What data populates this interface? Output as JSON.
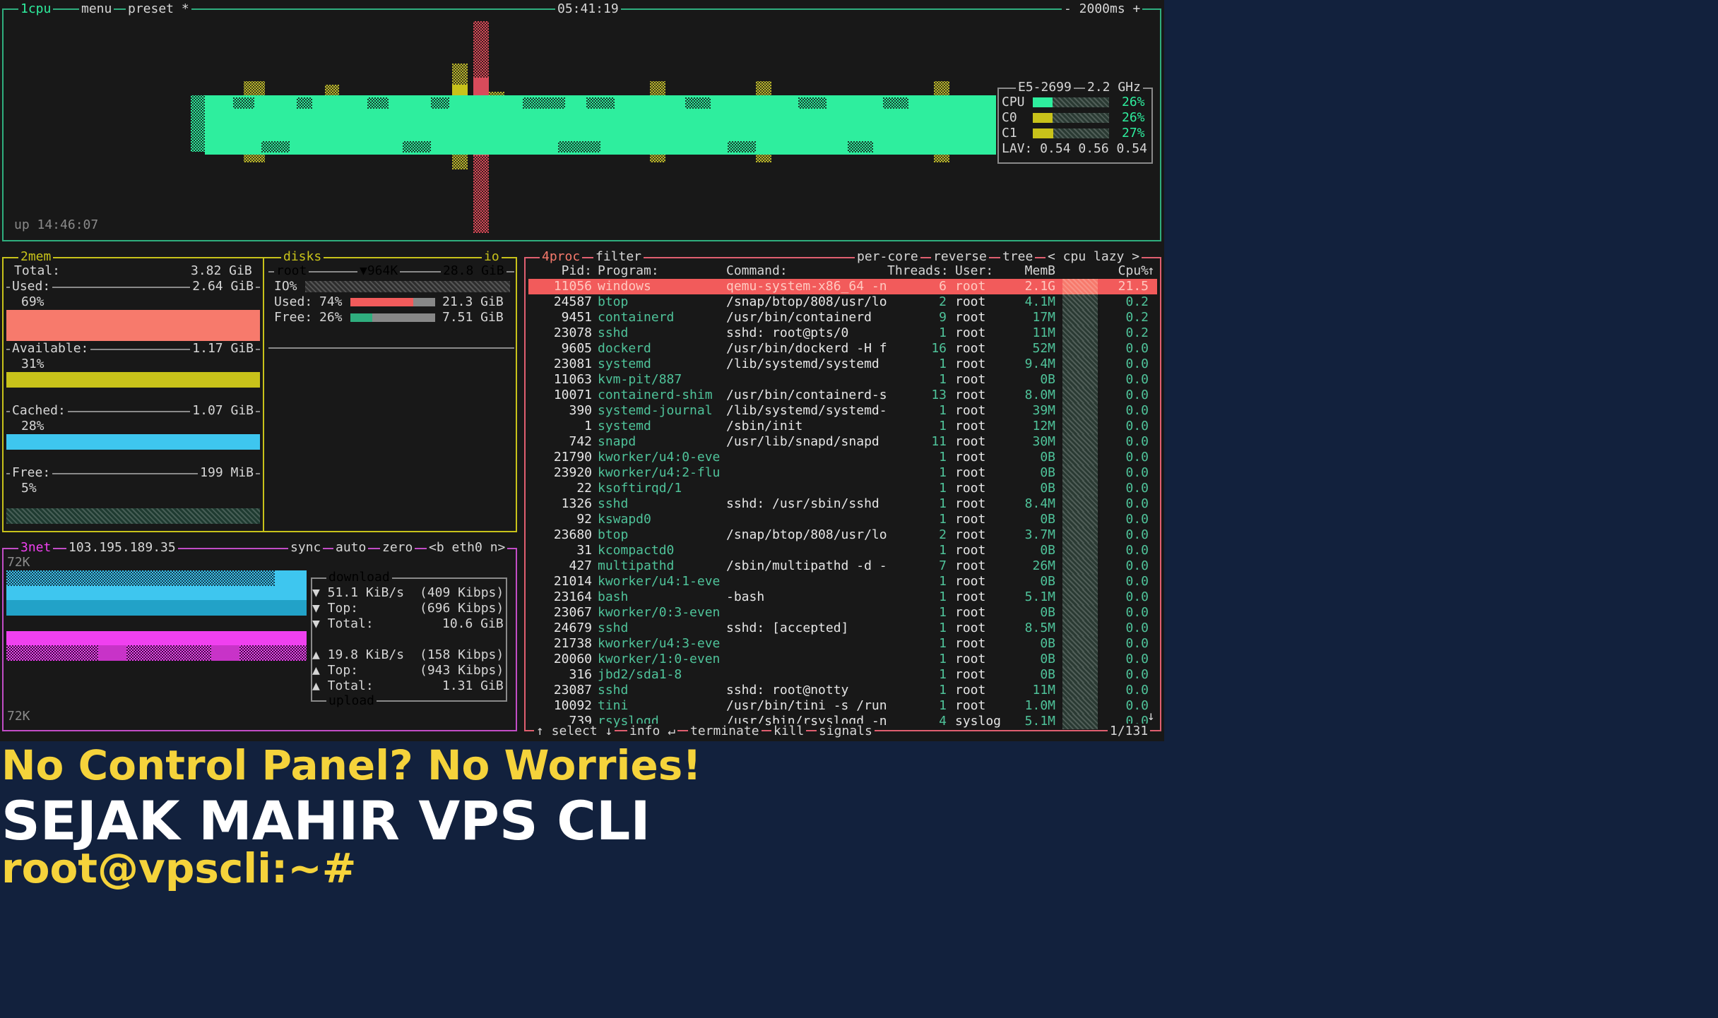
{
  "colors": {
    "cpu_border": "#2fae7e",
    "mem_border": "#c8c21a",
    "net_border": "#c24dc6",
    "proc_border": "#e05f70",
    "accent_green": "#2eee9e",
    "accent_yellow": "#c8c21a",
    "accent_cyan": "#3ec6ef",
    "accent_magenta": "#f040f0",
    "accent_red": "#f77a6c",
    "banner_bg": "#12213d",
    "banner_yellow": "#f5d33b"
  },
  "cpu_box": {
    "tab_cpu": "1cpu",
    "tab_menu": "menu",
    "tab_preset": "preset *",
    "clock": "05:41:19",
    "interval": "- 2000ms +",
    "uptime": "up 14:46:07",
    "model": "E5-2699",
    "freq": "2.2 GHz",
    "rows": [
      {
        "label": "CPU",
        "pct": "26%",
        "value": 0.26
      },
      {
        "label": "C0",
        "pct": "26%",
        "value": 0.26
      },
      {
        "label": "C1",
        "pct": "27%",
        "value": 0.27
      }
    ],
    "lav": "LAV: 0.54 0.56 0.54"
  },
  "mem_box": {
    "tab": "2mem",
    "total_label": "Total:",
    "total_value": "3.82 GiB",
    "items": [
      {
        "label": "Used:",
        "value": "2.64 GiB",
        "pct": "69%",
        "fraction": 0.69,
        "color": "#f77a6c"
      },
      {
        "label": "Available:",
        "value": "1.17 GiB",
        "pct": "31%",
        "fraction": 0.31,
        "color": "#c8c21a"
      },
      {
        "label": "Cached:",
        "value": "1.07 GiB",
        "pct": "28%",
        "fraction": 0.28,
        "color": "#3ec6ef"
      },
      {
        "label": "Free:",
        "value": "199 MiB",
        "pct": "5%",
        "fraction": 0.05,
        "color": "#2fae7e"
      }
    ]
  },
  "disks_box": {
    "tab": "disks",
    "io_tab": "io",
    "root_label": "root",
    "root_io": "▼964K",
    "root_size": "28.8 GiB",
    "io_label": "IO%",
    "used_label": "Used:",
    "used_pct": "74%",
    "used_fraction": 0.74,
    "used_size": "21.3 GiB",
    "free_label": "Free:",
    "free_pct": "26%",
    "free_fraction": 0.26,
    "free_size": "7.51 GiB"
  },
  "net_box": {
    "tab": "3net",
    "ip": "103.195.189.35",
    "tab_sync": "sync",
    "tab_auto": "auto",
    "tab_zero": "zero",
    "tab_iface": "<b eth0 n>",
    "scale_top": "72K",
    "scale_bottom": "72K",
    "download_label": "download",
    "upload_label": "upload",
    "down_rate": "▼ 51.1 KiB/s",
    "down_rate_bits": "(409 Kibps)",
    "down_top": "▼ Top:",
    "down_top_value": "(696 Kibps)",
    "down_total": "▼ Total:",
    "down_total_value": "10.6 GiB",
    "up_rate": "▲ 19.8 KiB/s",
    "up_rate_bits": "(158 Kibps)",
    "up_top": "▲ Top:",
    "up_top_value": "(943 Kibps)",
    "up_total": "▲ Total:",
    "up_total_value": "1.31 GiB"
  },
  "proc_box": {
    "tab": "4proc",
    "filter": "filter",
    "per_core": "per-core",
    "reverse": "reverse",
    "tree": "tree",
    "sort": "< cpu lazy >",
    "headers": {
      "pid": "Pid:",
      "program": "Program:",
      "command": "Command:",
      "threads": "Threads:",
      "user": "User:",
      "mem": "MemB",
      "cpu": "Cpu%"
    },
    "footer_select": "↑ select ↓",
    "footer_info": "info ↵",
    "footer_terminate": "terminate",
    "footer_kill": "kill",
    "footer_signals": "signals",
    "footer_count": "1/131",
    "scroll_up": "↑",
    "scroll_down": "↓",
    "rows": [
      {
        "pid": "11056",
        "program": "windows",
        "command": "qemu-system-x86_64 -n",
        "threads": "6",
        "user": "root",
        "mem": "2.1G",
        "cpu": "21.5"
      },
      {
        "pid": "24587",
        "program": "btop",
        "command": "/snap/btop/808/usr/lo",
        "threads": "2",
        "user": "root",
        "mem": "4.1M",
        "cpu": "0.2"
      },
      {
        "pid": "9451",
        "program": "containerd",
        "command": "/usr/bin/containerd",
        "threads": "9",
        "user": "root",
        "mem": "17M",
        "cpu": "0.2"
      },
      {
        "pid": "23078",
        "program": "sshd",
        "command": "sshd: root@pts/0",
        "threads": "1",
        "user": "root",
        "mem": "11M",
        "cpu": "0.2"
      },
      {
        "pid": "9605",
        "program": "dockerd",
        "command": "/usr/bin/dockerd -H f",
        "threads": "16",
        "user": "root",
        "mem": "52M",
        "cpu": "0.0"
      },
      {
        "pid": "23081",
        "program": "systemd",
        "command": "/lib/systemd/systemd",
        "threads": "1",
        "user": "root",
        "mem": "9.4M",
        "cpu": "0.0"
      },
      {
        "pid": "11063",
        "program": "kvm-pit/887",
        "command": "",
        "threads": "1",
        "user": "root",
        "mem": "0B",
        "cpu": "0.0"
      },
      {
        "pid": "10071",
        "program": "containerd-shim",
        "command": "/usr/bin/containerd-s",
        "threads": "13",
        "user": "root",
        "mem": "8.0M",
        "cpu": "0.0"
      },
      {
        "pid": "390",
        "program": "systemd-journal",
        "command": "/lib/systemd/systemd-",
        "threads": "1",
        "user": "root",
        "mem": "39M",
        "cpu": "0.0"
      },
      {
        "pid": "1",
        "program": "systemd",
        "command": "/sbin/init",
        "threads": "1",
        "user": "root",
        "mem": "12M",
        "cpu": "0.0"
      },
      {
        "pid": "742",
        "program": "snapd",
        "command": "/usr/lib/snapd/snapd",
        "threads": "11",
        "user": "root",
        "mem": "30M",
        "cpu": "0.0"
      },
      {
        "pid": "21790",
        "program": "kworker/u4:0-eve",
        "command": "",
        "threads": "1",
        "user": "root",
        "mem": "0B",
        "cpu": "0.0"
      },
      {
        "pid": "23920",
        "program": "kworker/u4:2-flu",
        "command": "",
        "threads": "1",
        "user": "root",
        "mem": "0B",
        "cpu": "0.0"
      },
      {
        "pid": "22",
        "program": "ksoftirqd/1",
        "command": "",
        "threads": "1",
        "user": "root",
        "mem": "0B",
        "cpu": "0.0"
      },
      {
        "pid": "1326",
        "program": "sshd",
        "command": "sshd: /usr/sbin/sshd",
        "threads": "1",
        "user": "root",
        "mem": "8.4M",
        "cpu": "0.0"
      },
      {
        "pid": "92",
        "program": "kswapd0",
        "command": "",
        "threads": "1",
        "user": "root",
        "mem": "0B",
        "cpu": "0.0"
      },
      {
        "pid": "23680",
        "program": "btop",
        "command": "/snap/btop/808/usr/lo",
        "threads": "2",
        "user": "root",
        "mem": "3.7M",
        "cpu": "0.0"
      },
      {
        "pid": "31",
        "program": "kcompactd0",
        "command": "",
        "threads": "1",
        "user": "root",
        "mem": "0B",
        "cpu": "0.0"
      },
      {
        "pid": "427",
        "program": "multipathd",
        "command": "/sbin/multipathd -d -",
        "threads": "7",
        "user": "root",
        "mem": "26M",
        "cpu": "0.0"
      },
      {
        "pid": "21014",
        "program": "kworker/u4:1-eve",
        "command": "",
        "threads": "1",
        "user": "root",
        "mem": "0B",
        "cpu": "0.0"
      },
      {
        "pid": "23164",
        "program": "bash",
        "command": "-bash",
        "threads": "1",
        "user": "root",
        "mem": "5.1M",
        "cpu": "0.0"
      },
      {
        "pid": "23067",
        "program": "kworker/0:3-even",
        "command": "",
        "threads": "1",
        "user": "root",
        "mem": "0B",
        "cpu": "0.0"
      },
      {
        "pid": "24679",
        "program": "sshd",
        "command": "sshd: [accepted]",
        "threads": "1",
        "user": "root",
        "mem": "8.5M",
        "cpu": "0.0"
      },
      {
        "pid": "21738",
        "program": "kworker/u4:3-eve",
        "command": "",
        "threads": "1",
        "user": "root",
        "mem": "0B",
        "cpu": "0.0"
      },
      {
        "pid": "20060",
        "program": "kworker/1:0-even",
        "command": "",
        "threads": "1",
        "user": "root",
        "mem": "0B",
        "cpu": "0.0"
      },
      {
        "pid": "316",
        "program": "jbd2/sda1-8",
        "command": "",
        "threads": "1",
        "user": "root",
        "mem": "0B",
        "cpu": "0.0"
      },
      {
        "pid": "23087",
        "program": "sshd",
        "command": "sshd: root@notty",
        "threads": "1",
        "user": "root",
        "mem": "11M",
        "cpu": "0.0"
      },
      {
        "pid": "10092",
        "program": "tini",
        "command": "/usr/bin/tini -s /run",
        "threads": "1",
        "user": "root",
        "mem": "1.0M",
        "cpu": "0.0"
      },
      {
        "pid": "739",
        "program": "rsyslogd",
        "command": "/usr/sbin/rsyslogd -n",
        "threads": "4",
        "user": "syslog",
        "mem": "5.1M",
        "cpu": "0.0"
      }
    ]
  },
  "banner": {
    "line1": "No Control Panel? No Worries!",
    "line2": "SEJAK MAHIR VPS CLI",
    "line3": "root@vpscli:~#"
  }
}
